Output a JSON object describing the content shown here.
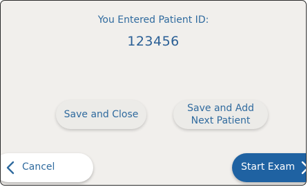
{
  "header": {
    "prompt": "You Entered Patient ID:",
    "patient_id": "123456"
  },
  "actions": {
    "save_close_label": "Save and Close",
    "save_add_line1": "Save and Add",
    "save_add_line2": "Next Patient"
  },
  "footer": {
    "cancel_label": "Cancel",
    "start_label": "Start Exam"
  },
  "colors": {
    "background": "#f1efec",
    "text_blue": "#2f6a9e",
    "primary_button": "#1f62a2"
  },
  "icons": {
    "cancel": "chevron-left-icon",
    "start": "chevron-right-icon"
  }
}
